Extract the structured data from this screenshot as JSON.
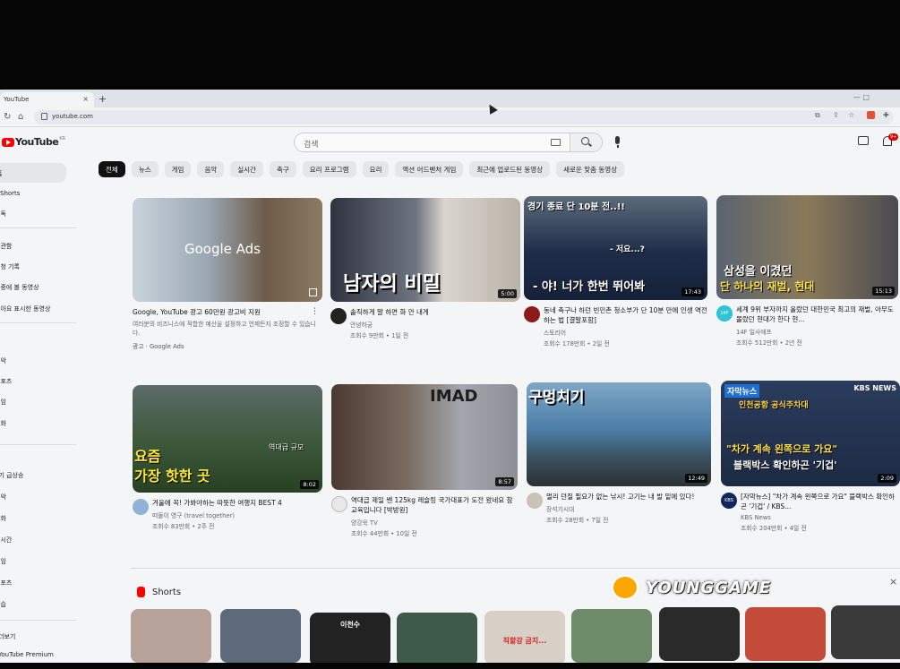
{
  "browser": {
    "tab_title": "YouTube",
    "tab_close": "×",
    "new_tab": "+",
    "url": "youtube.com",
    "window_controls": "— □"
  },
  "header": {
    "logo_text": "YouTube",
    "logo_region": "KR",
    "search_placeholder": "검색",
    "notification_badge": "9+"
  },
  "sidebar": {
    "items": [
      "홈",
      "Shorts",
      "구독",
      "보관함",
      "시청 기록",
      "나중에 볼 동영상",
      "좋아요 표시한 동영상",
      "음악",
      "스포츠",
      "게임",
      "영화",
      "인기 급상승",
      "음악",
      "영화",
      "실시간",
      "게임",
      "스포츠",
      "학습",
      "더보기",
      "YouTube Premium"
    ]
  },
  "chips": [
    "전체",
    "뉴스",
    "게임",
    "음악",
    "실시간",
    "축구",
    "요리 프로그램",
    "요리",
    "액션 어드벤처 게임",
    "최근에 업로드된 동영상",
    "새로운 맞춤 동영상"
  ],
  "videos": [
    {
      "title": "Google, YouTube 광고 60만원 광고비 지원",
      "desc": "여러분의 비즈니스에 적합한 예산을 설정하고 언제든지 조정할 수 있습니다.",
      "ad_label": "광고 · Google Ads",
      "thumb_text": "Google Ads"
    },
    {
      "title": "솔직하게 말 하면 화 안 내게",
      "channel": "안녕하궁",
      "stats": "조회수 9만회 • 1일 전",
      "duration": "5:00",
      "thumb_text": "남자의 비밀"
    },
    {
      "title": "동네 축구나 하던 빈민촌 청소부가 단 10분 만에 인생 역전하는 법 [결말포함]",
      "channel": "스토리어",
      "stats": "조회수 178만회 • 2일 전",
      "duration": "17:43",
      "thumb_top": "경기 종료 단 10분 전..!!",
      "thumb_mid": "- 저요...?",
      "thumb_bottom": "- 야! 너가 한번 뛰어봐"
    },
    {
      "title": "세계 9위 부자까지 올랐던 대한민국 최고의 재벌, 아무도 몰랐던 현대가 한다 현...",
      "channel": "14F 일사에프",
      "stats": "조회수 512만회 • 2년 전",
      "duration": "15:13",
      "thumb_line1": "삼성을 이겼던",
      "thumb_line2": "단 하나의 재벌, 현대",
      "avatar_text": "14F"
    },
    {
      "title": "겨울에 꼭! 가봐야하는 따뜻한 여행지 BEST 4",
      "channel": "떠돌이 영구 (travel together)",
      "stats": "조회수 83만회 • 2주 전",
      "duration": "8:02",
      "thumb_line1": "요즘",
      "thumb_line2": "가장 핫한 곳",
      "thumb_note": "역대급 규모"
    },
    {
      "title": "역대급 제일 쎈 125kg 레슬링 국가대표가 도전 왔네요 참교육입니다 [박방원]",
      "channel": "양강욱 TV",
      "stats": "조회수 44만회 • 10일 전",
      "duration": "8:57",
      "thumb_text": "IMAD"
    },
    {
      "title": "멀리 던질 필요가 없는 낚시! 고기는 내 발 밑에 있다!",
      "channel": "장석기시대",
      "stats": "조회수 28만회 • 7일 전",
      "duration": "12:49",
      "thumb_text": "구멍치기"
    },
    {
      "title": "[자막뉴스] \"차가 계속 왼쪽으로 가요\" 블랙박스 확인하곤 '기겁' / KBS...",
      "channel": "KBS News",
      "stats": "조회수 204만회 • 4일 전",
      "duration": "2:09",
      "thumb_tag": "자막뉴스",
      "thumb_sub": "인천공항 공식주차대",
      "thumb_line1": "\"차가 계속 왼쪽으로 가요\"",
      "thumb_line2": "블랙박스 확인하곤 '기겁'",
      "brand": "KBS NEWS",
      "avatar_text": "KBS"
    }
  ],
  "shorts": {
    "section_title": "Shorts",
    "close": "×",
    "items": [
      "",
      "",
      "이천수",
      "",
      "직할강 금지...",
      "",
      "",
      "",
      ""
    ]
  },
  "watermark": "YOUNGGAME",
  "colors": {
    "yt_red": "#ff0000",
    "chip_selected": "#111111",
    "screen_bg": "#f4f5f7"
  }
}
